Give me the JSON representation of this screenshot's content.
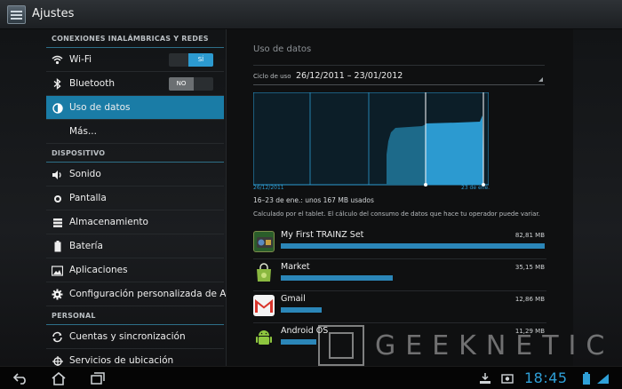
{
  "app": {
    "title": "Ajustes"
  },
  "sidebar": {
    "sections": [
      {
        "header": "CONEXIONES INALÁMBRICAS Y REDES",
        "items": [
          {
            "label": "Wi-Fi",
            "icon": "wifi-icon",
            "toggle": "SÍ",
            "state": "on"
          },
          {
            "label": "Bluetooth",
            "icon": "bluetooth-icon",
            "toggle": "NO",
            "state": "off"
          },
          {
            "label": "Uso de datos",
            "icon": "data-usage-icon",
            "selected": true
          },
          {
            "label": "Más...",
            "icon": ""
          }
        ]
      },
      {
        "header": "DISPOSITIVO",
        "items": [
          {
            "label": "Sonido",
            "icon": "sound-icon"
          },
          {
            "label": "Pantalla",
            "icon": "display-icon"
          },
          {
            "label": "Almacenamiento",
            "icon": "storage-icon"
          },
          {
            "label": "Batería",
            "icon": "battery-icon"
          },
          {
            "label": "Aplicaciones",
            "icon": "apps-icon"
          },
          {
            "label": "Configuración personalizada de ASUS",
            "icon": "gear-icon"
          }
        ]
      },
      {
        "header": "PERSONAL",
        "items": [
          {
            "label": "Cuentas y sincronización",
            "icon": "sync-icon"
          },
          {
            "label": "Servicios de ubicación",
            "icon": "location-icon"
          }
        ]
      }
    ]
  },
  "main": {
    "title": "Uso de datos",
    "cycle_label": "Ciclo de uso",
    "cycle_value": "26/12/2011 – 23/01/2012",
    "chart_start_label": "26/12/2011",
    "chart_end_label": "23 de ene.",
    "usage_text": "16–23 de ene.: unos 167 MB usados",
    "calc_text": "Calculado por el tablet. El cálculo del consumo de datos que hace tu operador puede variar.",
    "apps": [
      {
        "name": "My First TRAINZ Set",
        "size": "82,81 MB",
        "fraction": 1.0,
        "icon": "trainz-icon"
      },
      {
        "name": "Market",
        "size": "35,15 MB",
        "fraction": 0.424,
        "icon": "market-icon"
      },
      {
        "name": "Gmail",
        "size": "12,86 MB",
        "fraction": 0.155,
        "icon": "gmail-icon"
      },
      {
        "name": "Android OS",
        "size": "11,29 MB",
        "fraction": 0.136,
        "icon": "android-icon"
      }
    ]
  },
  "statusbar": {
    "clock": "18:45"
  },
  "watermark": {
    "text": "GEEKNETIC"
  },
  "colors": {
    "accent": "#2c9ad0",
    "selected": "#1a7ca6",
    "bar": "#2b86b8"
  }
}
